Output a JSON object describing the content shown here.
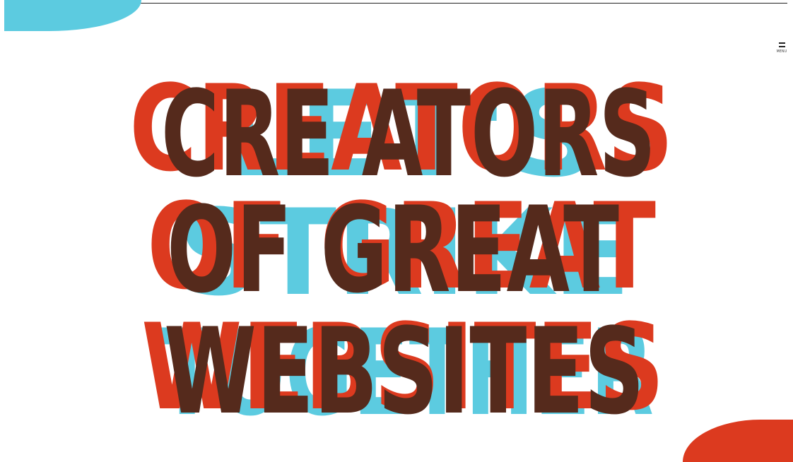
{
  "colors": {
    "cyan": "#5ccbe0",
    "red": "#dc3a1f",
    "brown": "#552a1c",
    "background": "#ffffff"
  },
  "header": {
    "menu_label": "MENU",
    "menu_icon": "hamburger-icon"
  },
  "hero": {
    "layer_cyan": [
      "LET'S",
      "STRIKE",
      "TOGETHER"
    ],
    "layer_red": [
      "CREATORS",
      "OF GREAT",
      "WEBSITES"
    ],
    "layer_brown": [
      "CRE ATORS",
      "OF GREAT",
      "WEBSITES"
    ]
  }
}
